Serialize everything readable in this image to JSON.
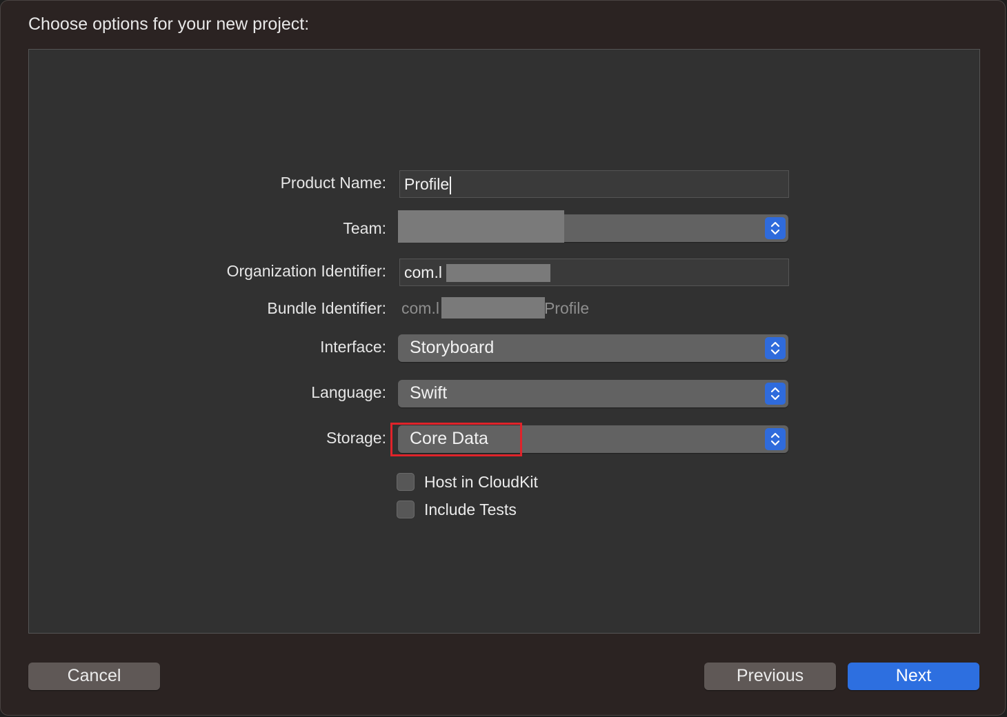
{
  "dialog": {
    "heading": "Choose options for your new project:"
  },
  "form": {
    "product_name": {
      "label": "Product Name:",
      "value": "Profile"
    },
    "team": {
      "label": "Team:",
      "value": ""
    },
    "organization_identifier": {
      "label": "Organization Identifier:",
      "value": "com.l"
    },
    "bundle_identifier": {
      "label": "Bundle Identifier:",
      "prefix": "com.l",
      "suffix": "Profile"
    },
    "interface": {
      "label": "Interface:",
      "value": "Storyboard"
    },
    "language": {
      "label": "Language:",
      "value": "Swift"
    },
    "storage": {
      "label": "Storage:",
      "value": "Core Data"
    },
    "host_in_cloudkit": {
      "label": "Host in CloudKit",
      "checked": false
    },
    "include_tests": {
      "label": "Include Tests",
      "checked": false
    }
  },
  "footer": {
    "cancel_label": "Cancel",
    "previous_label": "Previous",
    "next_label": "Next"
  },
  "colors": {
    "accent": "#2d6fe0",
    "highlight": "#e0232a"
  },
  "icons": {
    "popup_stepper": "chevron-up-down-icon"
  }
}
